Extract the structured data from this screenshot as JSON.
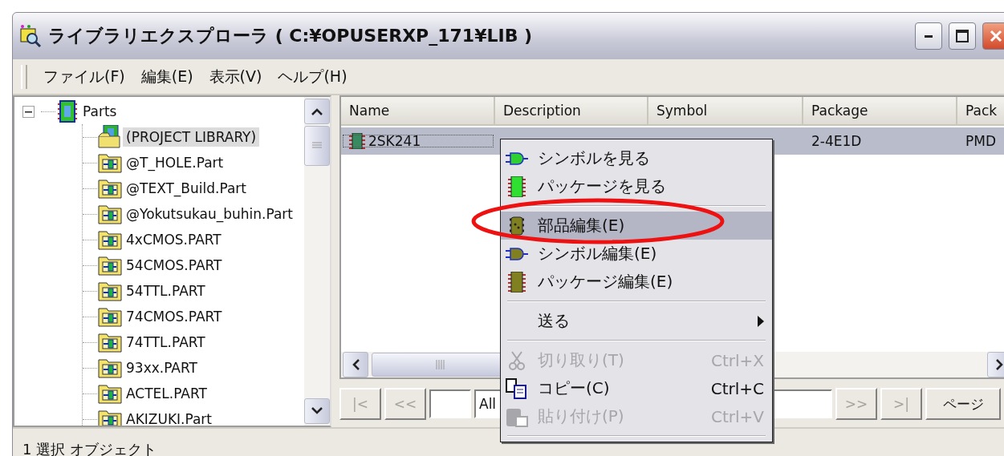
{
  "window": {
    "title": "ライブラリエクスプローラ ( C:¥OPUSERXP_171¥LIB )"
  },
  "menu_bar": [
    "ファイル(F)",
    "編集(E)",
    "表示(V)",
    "ヘルプ(H)"
  ],
  "tree": {
    "label": "Parts",
    "expanded": true,
    "children": [
      {
        "label": "(PROJECT LIBRARY)",
        "kind": "project",
        "selected": true
      },
      {
        "label": "@T_HOLE.Part",
        "kind": "part",
        "selected": false
      },
      {
        "label": "@TEXT_Build.Part",
        "kind": "part",
        "selected": false
      },
      {
        "label": "@Yokutsukau_buhin.Part",
        "kind": "part",
        "selected": false
      },
      {
        "label": "4xCMOS.PART",
        "kind": "part",
        "selected": false
      },
      {
        "label": "54CMOS.PART",
        "kind": "part",
        "selected": false
      },
      {
        "label": "54TTL.PART",
        "kind": "part",
        "selected": false
      },
      {
        "label": "74CMOS.PART",
        "kind": "part",
        "selected": false
      },
      {
        "label": "74TTL.PART",
        "kind": "part",
        "selected": false
      },
      {
        "label": "93xx.PART",
        "kind": "part",
        "selected": false
      },
      {
        "label": "ACTEL.PART",
        "kind": "part",
        "selected": false
      },
      {
        "label": "AKIZUKI.Part",
        "kind": "part",
        "selected": false
      }
    ]
  },
  "table": {
    "columns": [
      "Name",
      "Description",
      "Symbol",
      "Package",
      "Pack"
    ],
    "rows": [
      {
        "selected": true,
        "name": "2SK241",
        "package": "2-4E1D",
        "pack": "PMD"
      }
    ]
  },
  "pager": {
    "first": {
      "label": "|<",
      "disabled": true
    },
    "prev": {
      "label": "<<",
      "disabled": true
    },
    "filter": "All",
    "next": {
      "label": ">>",
      "disabled": true
    },
    "last": {
      "label": ">|",
      "disabled": true
    },
    "page_button": "ページ"
  },
  "context_menu": [
    {
      "kind": "item",
      "label": "シンボルを見る",
      "disabled": false,
      "selected": false,
      "submenu": false
    },
    {
      "kind": "item",
      "label": "パッケージを見る",
      "disabled": false,
      "selected": false,
      "submenu": false
    },
    {
      "kind": "separator"
    },
    {
      "kind": "item",
      "label": "部品編集(E)",
      "disabled": false,
      "selected": true,
      "submenu": false
    },
    {
      "kind": "item",
      "label": "シンボル編集(E)",
      "disabled": false,
      "selected": false,
      "submenu": false
    },
    {
      "kind": "item",
      "label": "パッケージ編集(E)",
      "disabled": false,
      "selected": false,
      "submenu": false
    },
    {
      "kind": "separator"
    },
    {
      "kind": "item",
      "label": "送る",
      "disabled": false,
      "selected": false,
      "submenu": true
    },
    {
      "kind": "separator"
    },
    {
      "kind": "item",
      "label": "切り取り(T)",
      "shortcut": "Ctrl+X",
      "disabled": true,
      "selected": false,
      "submenu": false
    },
    {
      "kind": "item",
      "label": "コピー(C)",
      "shortcut": "Ctrl+C",
      "disabled": false,
      "selected": false,
      "submenu": false
    },
    {
      "kind": "item",
      "label": "貼り付け(P)",
      "shortcut": "Ctrl+V",
      "disabled": true,
      "selected": false,
      "submenu": false
    },
    {
      "kind": "separator"
    }
  ],
  "status_bar": "1 選択 オブジェクト"
}
